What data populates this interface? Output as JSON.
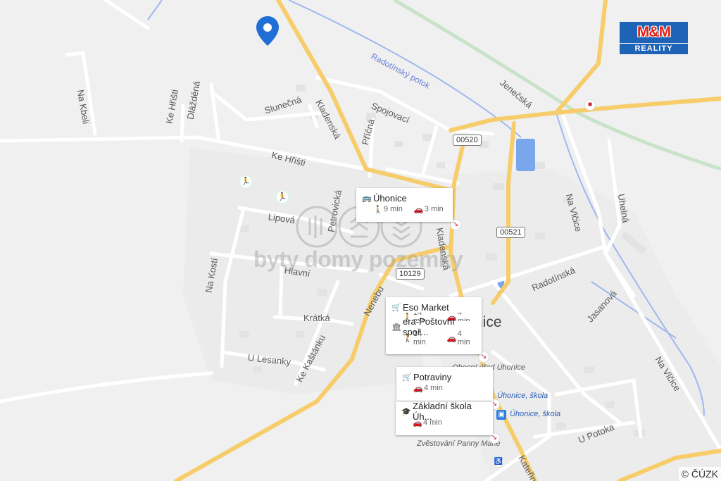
{
  "map": {
    "streets": [
      {
        "key": "na_kbeli",
        "text": "Na Kbeli"
      },
      {
        "key": "slunecna",
        "text": "Slunečná"
      },
      {
        "key": "kladenska_n",
        "text": "Kladenská"
      },
      {
        "key": "spojovaci",
        "text": "Spojovací"
      },
      {
        "key": "ke_hristi_v",
        "text": "Ke Hřišti"
      },
      {
        "key": "dlazdena",
        "text": "Dlážděná"
      },
      {
        "key": "ke_hristi_h",
        "text": "Ke Hřišti"
      },
      {
        "key": "pricna",
        "text": "Příčná"
      },
      {
        "key": "jenecska",
        "text": "Jenečská"
      },
      {
        "key": "na_vlcice_n",
        "text": "Na Vlčice"
      },
      {
        "key": "uhelna",
        "text": "Uhelná"
      },
      {
        "key": "lipova",
        "text": "Lipová"
      },
      {
        "key": "petrovicka",
        "text": "Petrovická"
      },
      {
        "key": "kladenska_s",
        "text": "Kladenská"
      },
      {
        "key": "hlavni",
        "text": "Hlavní"
      },
      {
        "key": "na_kosti",
        "text": "Na Kostí"
      },
      {
        "key": "kratka",
        "text": "Krátká"
      },
      {
        "key": "nenebu",
        "text": "Nenebu"
      },
      {
        "key": "radotinska",
        "text": "Radotínská"
      },
      {
        "key": "jasanova",
        "text": "Jasanová"
      },
      {
        "key": "u_lesanky",
        "text": "U Lesanky"
      },
      {
        "key": "ke_kastanku",
        "text": "Ke Kaštánku"
      },
      {
        "key": "na_vlcice_s",
        "text": "Na Vlčice"
      },
      {
        "key": "u_potoka",
        "text": "U Potoka"
      },
      {
        "key": "katerinska",
        "text": "Kateřinská"
      },
      {
        "key": "obecni_urad",
        "text": "Obecní úřad Úhonice"
      },
      {
        "key": "zvestovani",
        "text": "Zvěstování Panny Marie"
      }
    ],
    "water_labels": [
      {
        "key": "radotinsky_potok",
        "text": "Radotínský potok"
      }
    ],
    "road_numbers": [
      {
        "key": "r00520",
        "text": "00520"
      },
      {
        "key": "r00521",
        "text": "00521"
      },
      {
        "key": "r10129",
        "text": "10129"
      }
    ],
    "town_label": "nice",
    "bus_stops": [
      {
        "key": "stop1",
        "text": "Úhonice, škola"
      },
      {
        "key": "stop2",
        "text": "Úhonice, škola"
      }
    ]
  },
  "poi_cards": [
    {
      "key": "uhonice",
      "icon": "bus-icon",
      "title": "Úhonice",
      "walk": "9 min",
      "drive": "3 min"
    },
    {
      "key": "eso",
      "icon": "cart-icon",
      "title": "Eso Market",
      "walk": "14 min",
      "drive": "4 min"
    },
    {
      "key": "era",
      "icon": "bank-icon",
      "title": "era-Poštovní spoř...",
      "walk": "14 min",
      "drive": "4 min"
    },
    {
      "key": "potraviny",
      "icon": "cart-icon",
      "title": "Potraviny",
      "walk": "",
      "drive": "4 min"
    },
    {
      "key": "skola",
      "icon": "school-icon",
      "title": "Základní škola Úh...",
      "walk": "",
      "drive": "4 min"
    }
  ],
  "branding": {
    "logo_top": "M&M",
    "logo_bottom": "REALITY",
    "watermark": "byty domy pozemky",
    "copyright": "© ČÚZK"
  },
  "colors": {
    "background": "#f0f0f0",
    "major_road": "#f6cd6a",
    "minor_road": "#ffffff",
    "water": "#7aa6ec",
    "pin": "#1f6fd6",
    "logo_red": "#e2231a",
    "logo_blue": "#1f63b6"
  }
}
